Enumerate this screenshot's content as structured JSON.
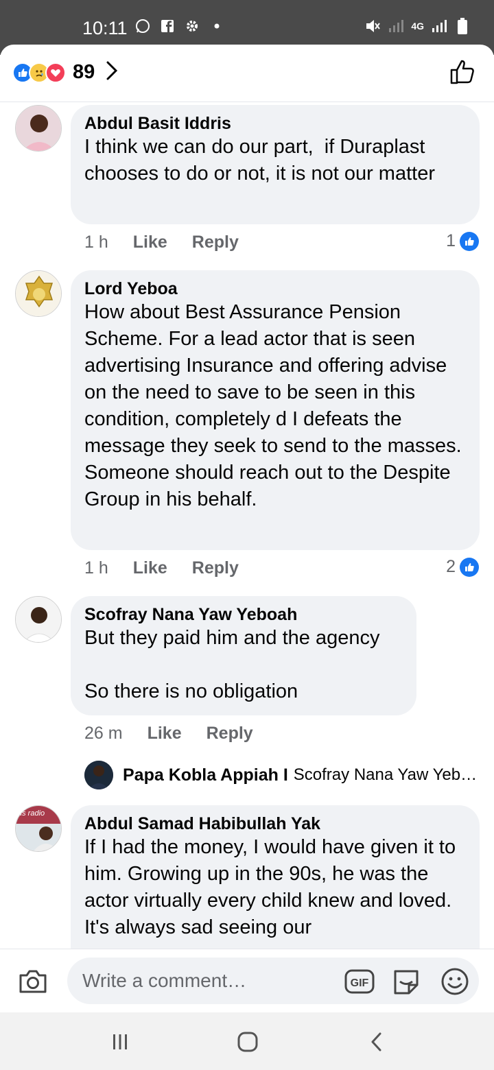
{
  "status_bar": {
    "time": "10:11",
    "network": "4G"
  },
  "header": {
    "reaction_count": "89"
  },
  "comments": [
    {
      "author": "Abdul Basit Iddris",
      "text": "I think we can do our part,  if Duraplast chooses to do or not, it is not our matter",
      "time": "1 h",
      "like_label": "Like",
      "reply_label": "Reply",
      "likes": "1"
    },
    {
      "author": "Lord Yeboa",
      "text": "How about Best Assurance Pension Scheme. For a lead actor that is seen advertising Insurance and offering advise on the need to save to be seen in this condition, completely d I defeats the message they seek to send to the masses.\nSomeone should reach out to the Despite Group in his behalf.",
      "time": "1 h",
      "like_label": "Like",
      "reply_label": "Reply",
      "likes": "2"
    },
    {
      "author": "Scofray Nana Yaw Yeboah",
      "text": "But they paid him and the agency\n\nSo there is no obligation",
      "time": "26 m",
      "like_label": "Like",
      "reply_label": "Reply",
      "reply_preview": {
        "author": "Papa Kobla Appiah I",
        "snippet": "Scofray Nana Yaw Yeboah"
      }
    },
    {
      "author": "Abdul Samad Habibullah Yak",
      "text": "If I had the money, I would have given it to him. Growing up in the 90s, he was the actor virtually every child knew and loved. It's always sad seeing our",
      "avatar_caption": "us radio"
    }
  ],
  "composer": {
    "placeholder": "Write a comment…",
    "gif_label": "GIF"
  },
  "colors": {
    "accent": "#1877f2",
    "bubble": "#f0f2f5",
    "meta": "#65676b",
    "status_bar": "#4a4a4a"
  },
  "icons": [
    "whatsapp-icon",
    "facebook-icon",
    "gear-icon",
    "mute-icon",
    "signal-icon",
    "battery-icon",
    "like-outline-icon",
    "camera-icon",
    "gif-icon",
    "sticker-icon",
    "emoji-icon",
    "recents-icon",
    "home-icon",
    "back-icon"
  ]
}
